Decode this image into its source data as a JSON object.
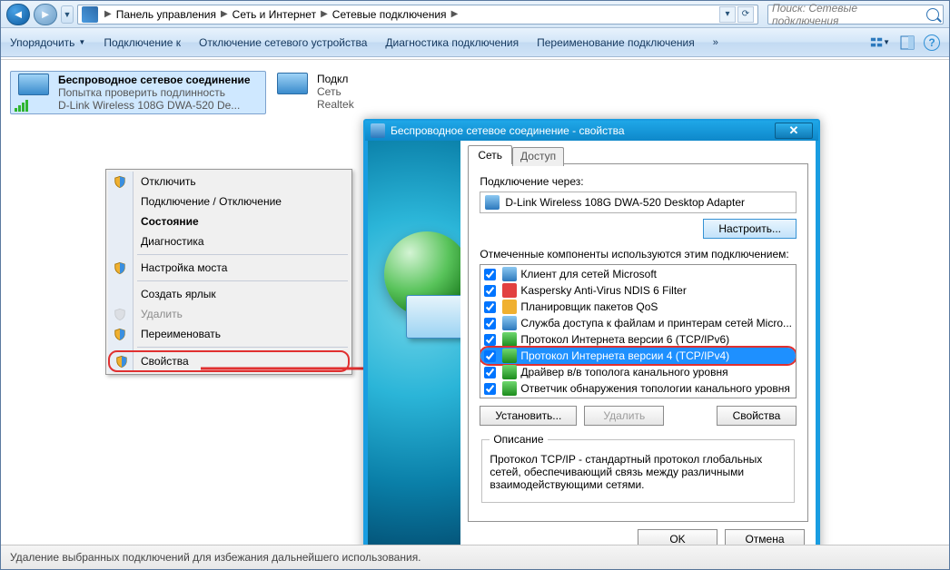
{
  "breadcrumb": {
    "c1": "Панель управления",
    "c2": "Сеть и Интернет",
    "c3": "Сетевые подключения"
  },
  "search": {
    "placeholder": "Поиск: Сетевые подключения"
  },
  "toolbar": {
    "organize": "Упорядочить",
    "connect": "Подключение к",
    "disable": "Отключение сетевого устройства",
    "diagnose": "Диагностика подключения",
    "rename": "Переименование подключения",
    "overflow": "»"
  },
  "connections": [
    {
      "title": "Беспроводное сетевое соединение",
      "line2": "Попытка проверить подлинность",
      "line3": "D-Link Wireless 108G DWA-520 De..."
    },
    {
      "title": "Подкл",
      "line2": "Сеть",
      "line3": "Realtek"
    }
  ],
  "context_menu": {
    "i1": "Отключить",
    "i2": "Подключение / Отключение",
    "i3": "Состояние",
    "i4": "Диагностика",
    "i5": "Настройка моста",
    "i6": "Создать ярлык",
    "i7": "Удалить",
    "i8": "Переименовать",
    "i9": "Свойства"
  },
  "dialog": {
    "title": "Беспроводное сетевое соединение - свойства",
    "tab1": "Сеть",
    "tab2": "Доступ",
    "connect_via": "Подключение через:",
    "adapter": "D-Link Wireless 108G DWA-520 Desktop Adapter",
    "configure": "Настроить...",
    "components_label": "Отмеченные компоненты используются этим подключением:",
    "components": [
      "Клиент для сетей Microsoft",
      "Kaspersky Anti-Virus NDIS 6 Filter",
      "Планировщик пакетов QoS",
      "Служба доступа к файлам и принтерам сетей Micro...",
      "Протокол Интернета версии 6 (TCP/IPv6)",
      "Протокол Интернета версии 4 (TCP/IPv4)",
      "Драйвер в/в тополога канального уровня",
      "Ответчик обнаружения топологии канального уровня"
    ],
    "install": "Установить...",
    "uninstall": "Удалить",
    "properties": "Свойства",
    "desc_legend": "Описание",
    "desc_text": "Протокол TCP/IP - стандартный протокол глобальных сетей, обеспечивающий связь между различными взаимодействующими сетями.",
    "ok": "OK",
    "cancel": "Отмена"
  },
  "status": "Удаление выбранных подключений для избежания дальнейшего использования."
}
